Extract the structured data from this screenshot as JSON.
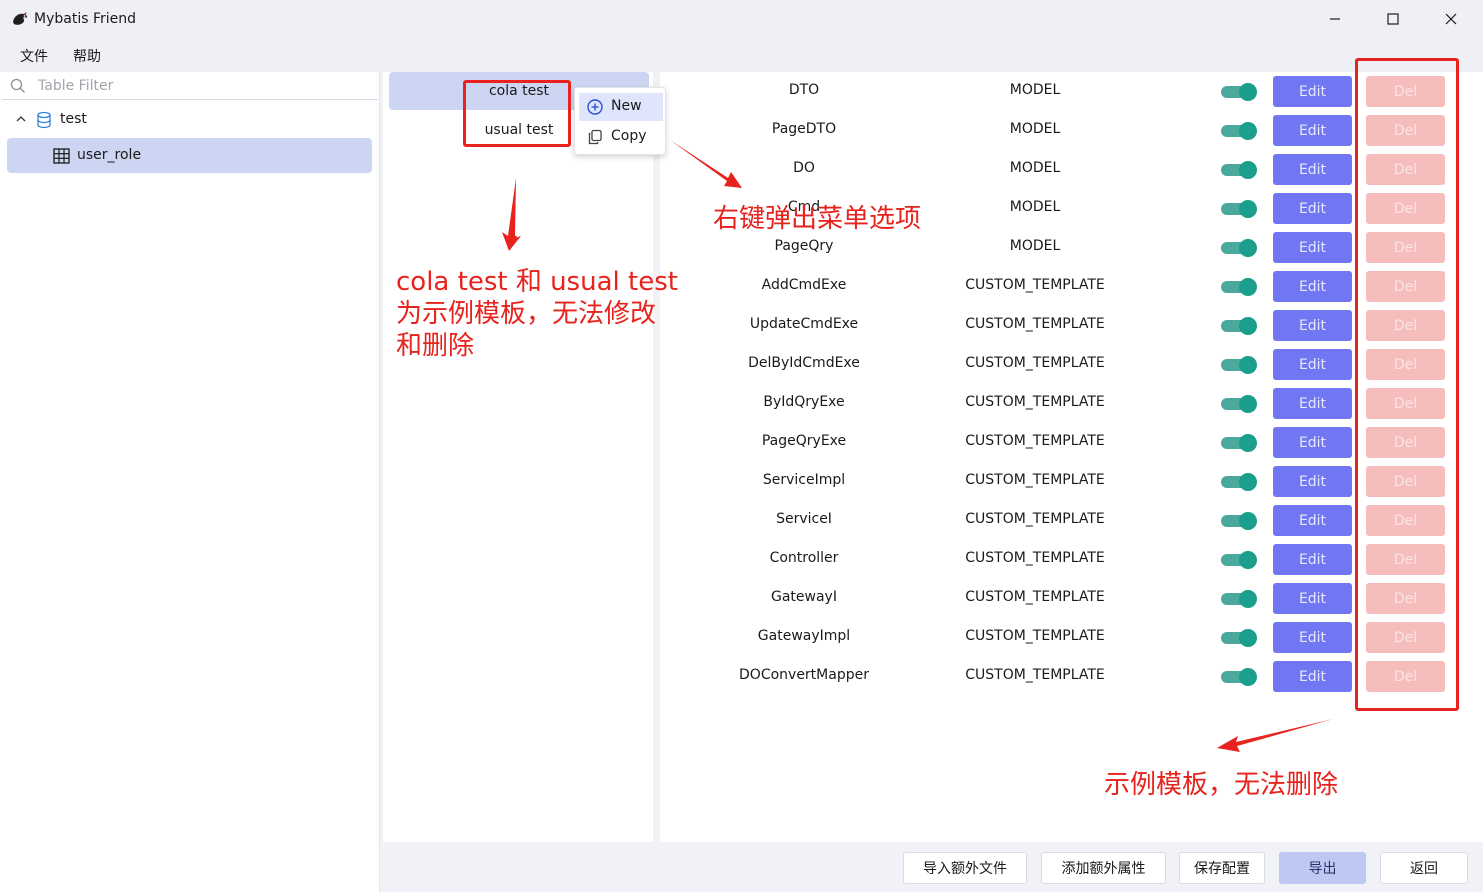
{
  "window": {
    "title": "Mybatis Friend",
    "controls": {
      "minimize": "minimize-icon",
      "maximize": "maximize-icon",
      "close": "close-icon"
    }
  },
  "menubar": {
    "items": [
      "文件",
      "帮助"
    ]
  },
  "sidebar": {
    "filter_placeholder": "Table Filter",
    "tree": {
      "database": "test",
      "table": "user_role"
    }
  },
  "templates": {
    "items": [
      "cola test",
      "usual test"
    ],
    "selected": "cola test"
  },
  "context_menu": {
    "items": [
      {
        "label": "New",
        "icon": "plus-circle-icon"
      },
      {
        "label": "Copy",
        "icon": "copy-icon"
      }
    ]
  },
  "rows": [
    {
      "name": "DTO",
      "type": "MODEL",
      "enabled": true
    },
    {
      "name": "PageDTO",
      "type": "MODEL",
      "enabled": true
    },
    {
      "name": "DO",
      "type": "MODEL",
      "enabled": true
    },
    {
      "name": "Cmd",
      "type": "MODEL",
      "enabled": true
    },
    {
      "name": "PageQry",
      "type": "MODEL",
      "enabled": true
    },
    {
      "name": "AddCmdExe",
      "type": "CUSTOM_TEMPLATE",
      "enabled": true
    },
    {
      "name": "UpdateCmdExe",
      "type": "CUSTOM_TEMPLATE",
      "enabled": true
    },
    {
      "name": "DelByIdCmdExe",
      "type": "CUSTOM_TEMPLATE",
      "enabled": true
    },
    {
      "name": "ByIdQryExe",
      "type": "CUSTOM_TEMPLATE",
      "enabled": true
    },
    {
      "name": "PageQryExe",
      "type": "CUSTOM_TEMPLATE",
      "enabled": true
    },
    {
      "name": "ServiceImpl",
      "type": "CUSTOM_TEMPLATE",
      "enabled": true
    },
    {
      "name": "ServiceI",
      "type": "CUSTOM_TEMPLATE",
      "enabled": true
    },
    {
      "name": "Controller",
      "type": "CUSTOM_TEMPLATE",
      "enabled": true
    },
    {
      "name": "GatewayI",
      "type": "CUSTOM_TEMPLATE",
      "enabled": true
    },
    {
      "name": "GatewayImpl",
      "type": "CUSTOM_TEMPLATE",
      "enabled": true
    },
    {
      "name": "DOConvertMapper",
      "type": "CUSTOM_TEMPLATE",
      "enabled": true
    }
  ],
  "row_buttons": {
    "edit": "Edit",
    "del": "Del"
  },
  "bottom_buttons": [
    "导入额外文件",
    "添加额外属性",
    "保存配置",
    "导出",
    "返回"
  ],
  "annotations": {
    "context_menu_note": "右键弹出菜单选项",
    "templates_note": [
      "cola test 和 usual test",
      "为示例模板，无法修改",
      "和删除"
    ],
    "delete_note": "示例模板，无法删除"
  },
  "colors": {
    "accent": "#7177f2",
    "del_disabled": "#f6bdbd",
    "toggle_on": "#1b9e8c",
    "selection": "#ccd6f3",
    "annotation_red": "#e8221c"
  }
}
